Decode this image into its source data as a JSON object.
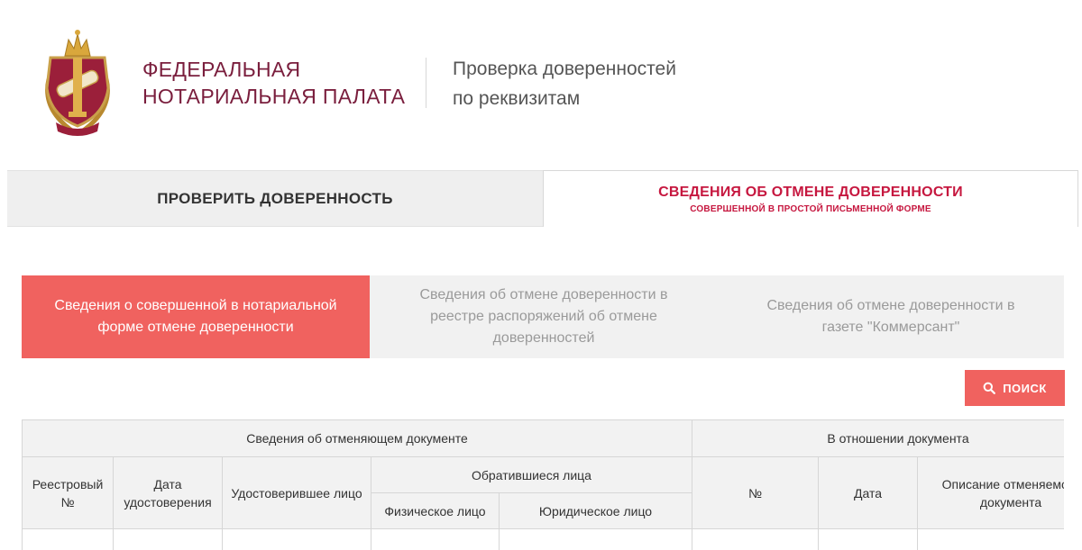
{
  "header": {
    "org_line1": "ФЕДЕРАЛЬНАЯ",
    "org_line2": "НОТАРИАЛЬНАЯ ПАЛАТА",
    "service_line1": "Проверка доверенностей",
    "service_line2": "по реквизитам",
    "logo_icon": "notary-emblem-icon"
  },
  "main_tabs": [
    {
      "label": "ПРОВЕРИТЬ ДОВЕРЕННОСТЬ",
      "active": false
    },
    {
      "label": "СВЕДЕНИЯ ОБ ОТМЕНЕ ДОВЕРЕННОСТИ",
      "sublabel": "СОВЕРШЕННОЙ В ПРОСТОЙ ПИСЬМЕННОЙ ФОРМЕ",
      "active": true
    }
  ],
  "sub_tabs": [
    {
      "label": "Сведения о совершенной в нотариальной форме отмене доверенности",
      "active": true
    },
    {
      "label": "Сведения об отмене доверенности в реестре распоряжений об отмене доверенностей",
      "active": false
    },
    {
      "label": "Сведения об отмене доверенности в газете \"Коммерсант\"",
      "active": false
    }
  ],
  "search_button": {
    "label": "ПОИСК",
    "icon": "search-icon"
  },
  "table": {
    "group_headers": {
      "canceling_document": "Сведения об отменяющем документе",
      "regarding_document": "В отношении документа"
    },
    "columns": {
      "registry_no": "Реестровый №",
      "certification_date": "Дата удостоверения",
      "certifying_person": "Удостоверившее лицо",
      "applicants": "Обратившиеся лица",
      "individual": "Физическое лицо",
      "legal_entity": "Юридическое лицо",
      "doc_no": "№",
      "doc_date": "Дата",
      "doc_description": "Описание отменяемого документа"
    }
  },
  "colors": {
    "accent_red": "#f0625f",
    "brand_crimson": "#c6173f",
    "org_maroon": "#7a1e3d",
    "tab_inactive_bg": "#efefef"
  }
}
